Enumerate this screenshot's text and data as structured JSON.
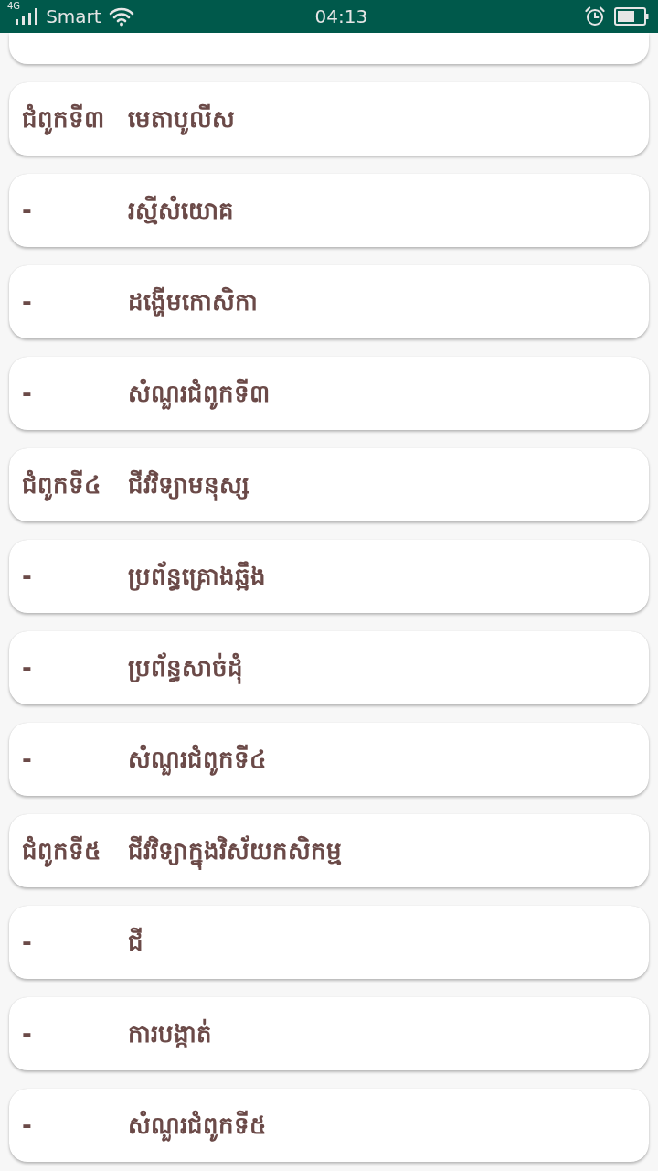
{
  "status_bar": {
    "network_type": "4G",
    "carrier": "Smart",
    "time": "04:13"
  },
  "list": {
    "items": [
      {
        "label": "ជំពូកទី៣",
        "title": "មេតាបូលីស"
      },
      {
        "label": "-",
        "title": "រស្មីសំយោគ"
      },
      {
        "label": "-",
        "title": "ដង្ហើមកោសិកា"
      },
      {
        "label": "-",
        "title": "សំណួរជំពូកទី៣"
      },
      {
        "label": "ជំពូកទី៤",
        "title": "ជីវវិទ្យាមនុស្ស"
      },
      {
        "label": "-",
        "title": "ប្រព័ន្ធគ្រោងឆ្អឹង"
      },
      {
        "label": "-",
        "title": "ប្រព័ន្ធសាច់ដុំ"
      },
      {
        "label": "-",
        "title": "សំណួរជំពូកទី៤"
      },
      {
        "label": "ជំពូកទី៥",
        "title": "ជីវវិទ្យាក្នុងវិស័យកសិកម្ម"
      },
      {
        "label": "-",
        "title": "ជី"
      },
      {
        "label": "-",
        "title": "ការបង្កាត់"
      },
      {
        "label": "-",
        "title": "សំណួរជំពូកទី៥"
      }
    ]
  }
}
